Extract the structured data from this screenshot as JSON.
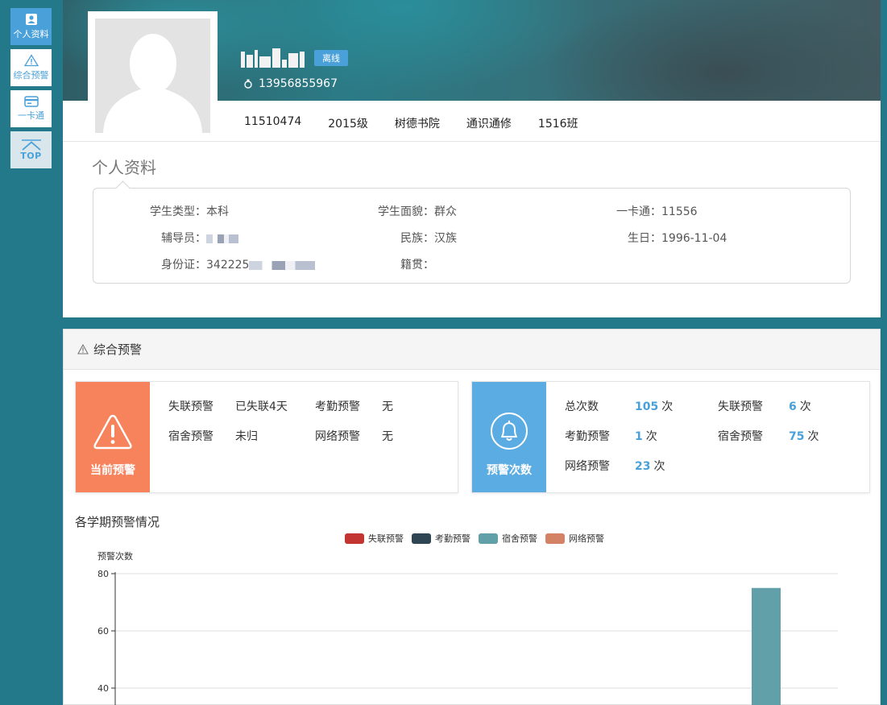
{
  "sidebar": {
    "items": [
      {
        "label": "个人资料",
        "icon": "profile-card-icon",
        "active": true
      },
      {
        "label": "综合预警",
        "icon": "warning-triangle-icon",
        "active": false
      },
      {
        "label": "一卡通",
        "icon": "card-icon",
        "active": false
      },
      {
        "label": "TOP",
        "icon": "chevron-up-icon",
        "active": false
      }
    ]
  },
  "profile": {
    "status_badge": "离线",
    "phone": "13956855967",
    "meta": [
      "11510474",
      "2015级",
      "树德书院",
      "通识通修",
      "1516班"
    ],
    "section_title": "个人资料",
    "info": {
      "student_type_label": "学生类型：",
      "student_type": "本科",
      "political_label": "学生面貌：",
      "political": "群众",
      "card_label": "一卡通：",
      "card": "11556",
      "counselor_label": "辅导员：",
      "ethnicity_label": "民族：",
      "ethnicity": "汉族",
      "birthday_label": "生日：",
      "birthday": "1996-11-04",
      "id_label": "身份证：",
      "id_prefix": "342225",
      "native_label": "籍贯："
    }
  },
  "warning": {
    "title": "综合预警",
    "current": {
      "label": "当前预警",
      "color": "#f7835d",
      "items": [
        {
          "name": "失联预警",
          "value": "已失联4天"
        },
        {
          "name": "考勤预警",
          "value": "无"
        },
        {
          "name": "宿舍预警",
          "value": "未归"
        },
        {
          "name": "网络预警",
          "value": "无"
        }
      ]
    },
    "count": {
      "label": "预警次数",
      "color": "#5aace2",
      "unit": "次",
      "items": [
        {
          "name": "总次数",
          "value": "105"
        },
        {
          "name": "失联预警",
          "value": "6"
        },
        {
          "name": "考勤预警",
          "value": "1"
        },
        {
          "name": "宿舍预警",
          "value": "75"
        },
        {
          "name": "网络预警",
          "value": "23"
        }
      ]
    }
  },
  "chart_data": {
    "type": "bar",
    "title": "各学期预警情况",
    "ylabel": "预警次数",
    "ylim": [
      0,
      80
    ],
    "yticks": [
      80,
      60,
      40
    ],
    "grid": true,
    "legend_position": "top",
    "series": [
      {
        "name": "失联预警",
        "color": "#c23531",
        "values": [
          null
        ]
      },
      {
        "name": "考勤预警",
        "color": "#2f4554",
        "values": [
          null
        ]
      },
      {
        "name": "宿舍预警",
        "color": "#61a0a8",
        "values": [
          75
        ]
      },
      {
        "name": "网络预警",
        "color": "#d48265",
        "values": [
          null
        ]
      }
    ]
  }
}
